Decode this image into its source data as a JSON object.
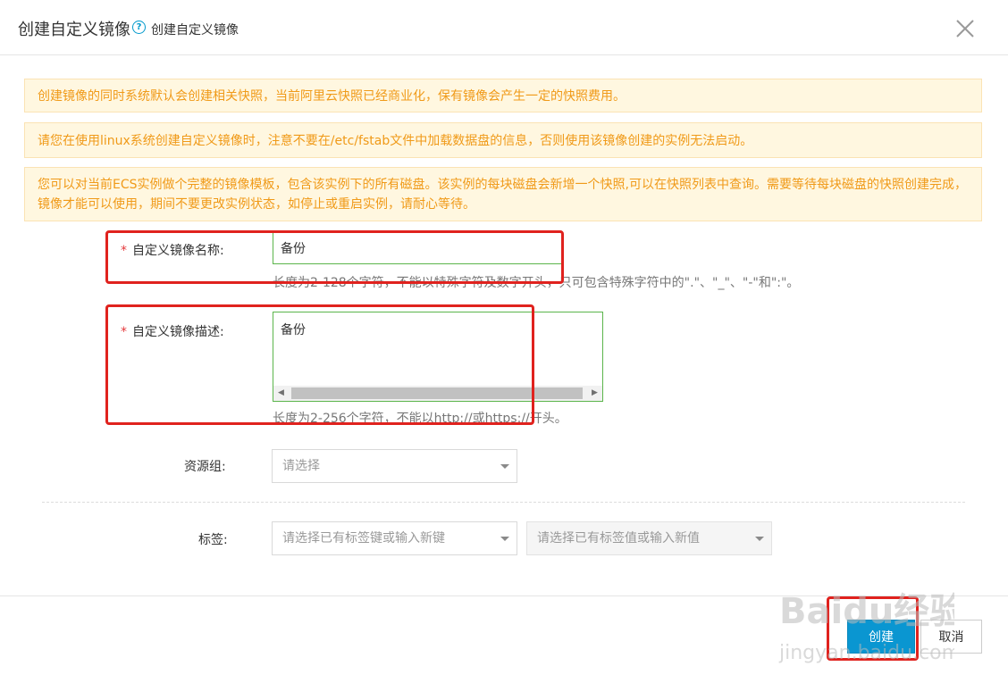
{
  "dialog": {
    "title": "创建自定义镜像",
    "help_text": "创建自定义镜像"
  },
  "notices": [
    "创建镜像的同时系统默认会创建相关快照，当前阿里云快照已经商业化，保有镜像会产生一定的快照费用。",
    "请您在使用linux系统创建自定义镜像时，注意不要在/etc/fstab文件中加载数据盘的信息，否则使用该镜像创建的实例无法启动。",
    "您可以对当前ECS实例做个完整的镜像模板，包含该实例下的所有磁盘。该实例的每块磁盘会新增一个快照,可以在快照列表中查询。需要等待每块磁盘的快照创建完成，镜像才能可以使用，期间不要更改实例状态，如停止或重启实例，请耐心等待。"
  ],
  "form": {
    "required_mark": "*",
    "name_label": "自定义镜像名称:",
    "name_value": "备份",
    "name_hint": "长度为2-128个字符，不能以特殊字符及数字开头，只可包含特殊字符中的\".\"、\"_\"、\"-\"和\":\"。",
    "desc_label": "自定义镜像描述:",
    "desc_value": "备份",
    "desc_hint": "长度为2-256个字符，不能以http://或https://开头。",
    "resource_group_label": "资源组:",
    "resource_group_placeholder": "请选择",
    "tag_label": "标签:",
    "tag_key_placeholder": "请选择已有标签键或输入新键",
    "tag_value_placeholder": "请选择已有标签值或输入新值"
  },
  "footer": {
    "create_label": "创建",
    "cancel_label": "取消"
  },
  "watermark": {
    "brand": "Baidu经验",
    "url": "jingyan.baidu.com"
  },
  "colors": {
    "accent": "#0a96d1",
    "notice_text": "#f09a18",
    "notice_bg": "#fff7e0",
    "required": "#e4393c",
    "input_border_active": "#5bb54b",
    "annotation": "#e0221e"
  }
}
